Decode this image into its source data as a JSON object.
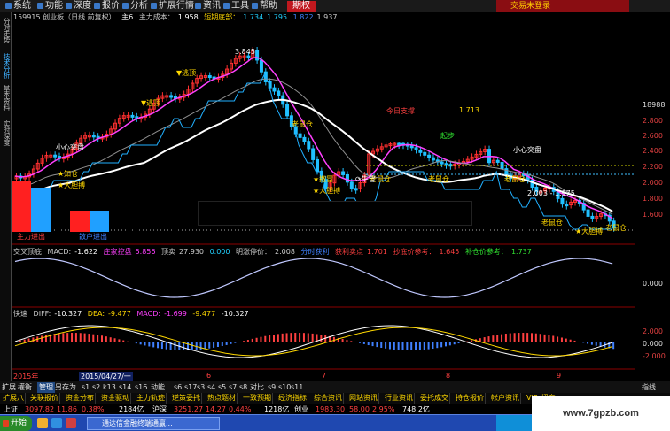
{
  "menu": {
    "items": [
      "系统",
      "功能",
      "深度",
      "报价",
      "分析",
      "扩展行情",
      "资讯",
      "工具",
      "帮助",
      "期权"
    ],
    "active_index": 9,
    "right_badge": "交易未登录"
  },
  "left_tabs": [
    "分时走势",
    "技术分析",
    "基本资料",
    "实时深度"
  ],
  "left_tabs_active": 1,
  "header": {
    "code_name": "159915 创业板（日线 前复权）",
    "indicator": "主6",
    "cost_label": "主力成本：",
    "cost_value": "1.958",
    "short_bottom_label": "短期底部：",
    "short_bottom_values": [
      "1.734",
      "1.795"
    ],
    "extra_values": [
      "1.822",
      "1.937"
    ]
  },
  "support": {
    "label1": "今日支撑",
    "value1": "1.713"
  },
  "price_axis": {
    "top_label": "18988",
    "ticks": [
      "2.800",
      "2.600",
      "2.400",
      "2.200",
      "2.000",
      "1.800",
      "1.600"
    ]
  },
  "annotations": {
    "high": "3.845",
    "low_range": "2.003 - 1.975",
    "attention": "小心突盘",
    "attention2": "小心突盘",
    "escape1": "逃顶",
    "escape2": "逃顶",
    "buy1": "知仓",
    "buy2": "大胆搏",
    "buy3": "大胆搏",
    "buy4": "大胆搏",
    "bear1": "老鼠仓",
    "bear2": "老鼠仓",
    "bear3": "老鼠仓",
    "bear4": "老鼠仓",
    "bear5": "老鼠仓",
    "bear6": "老鼠仓",
    "strong": "牛冒",
    "strong2": "撒冒",
    "up": "起步",
    "main_in": "主力进出",
    "retail_in": "散户进出"
  },
  "macd_panel": {
    "title": "交叉顶底",
    "macd_label": "MACD:",
    "macd_value": "-1.622",
    "ctrl_label": "庄家控盘",
    "ctrl_value": "5.856",
    "top_label": "顶卖",
    "top_value": "27.930",
    "zero": "0.000",
    "limit_label": "明涨停价：",
    "limit_value": "2.008",
    "flat_label": "分时获利",
    "flat_value": "",
    "sell_label": "获利卖点",
    "sell_value": "1.701",
    "buy_label": "抄底价参考：",
    "buy_value": "1.645",
    "add_label": "补仓价参考：",
    "add_value": "1.737",
    "axis": [
      "0.000"
    ]
  },
  "diff_panel": {
    "title": "快速",
    "diff_label": "DIFF:",
    "diff_value": "-10.327",
    "dea_label": "DEA:",
    "dea_value": "-9.477",
    "macd_label": "MACD:",
    "macd_value": "-1.699",
    "v2": "-9.477",
    "v3": "-10.327",
    "axis": [
      "2.000",
      "0.000",
      "-2.000"
    ]
  },
  "time_axis": {
    "year": "2015年",
    "date": "2015/04/27/一",
    "months": [
      "6",
      "7",
      "8",
      "9"
    ]
  },
  "tabs": {
    "items": [
      "扩展",
      "權衡",
      "管理",
      "另存为",
      "s1",
      "s2",
      "k13",
      "s14",
      "s16",
      "动能",
      "s6",
      "s17",
      "s3",
      "s4",
      "s5",
      "s7",
      "s8",
      "对比",
      "s9",
      "s10",
      "s11"
    ],
    "active_index": 2,
    "right": "指线"
  },
  "function_bar": [
    "扩展八",
    "关联报价",
    "资金分布",
    "资金驱动",
    "主力轨迹",
    "逆策委托",
    "热点题材",
    "一致预期",
    "经济指标",
    "综合资讯",
    "网站资讯",
    "行业资讯",
    "委托成交",
    "持仓报价",
    "帐户资讯",
    "VIP_招商"
  ],
  "ticker": {
    "sh_label": "上证",
    "sh_value": "3097.82",
    "sh_chg": "11.86",
    "sh_pct": "0.38%",
    "sh_vol": "2184亿",
    "sz_label": "沪深",
    "sz_value": "3251.27",
    "sz_chg": "14.27",
    "sz_pct": "0.44%",
    "sz_vol": "1218亿",
    "cy_label": "创业",
    "cy_value": "1983.30",
    "cy_chg": "58.00",
    "cy_pct": "2.95%",
    "cy_vol": "748.2亿"
  },
  "taskbar": {
    "start": "开始",
    "window": "通达信金融终端通赢..."
  },
  "watermark": "www.7gpzb.com"
}
